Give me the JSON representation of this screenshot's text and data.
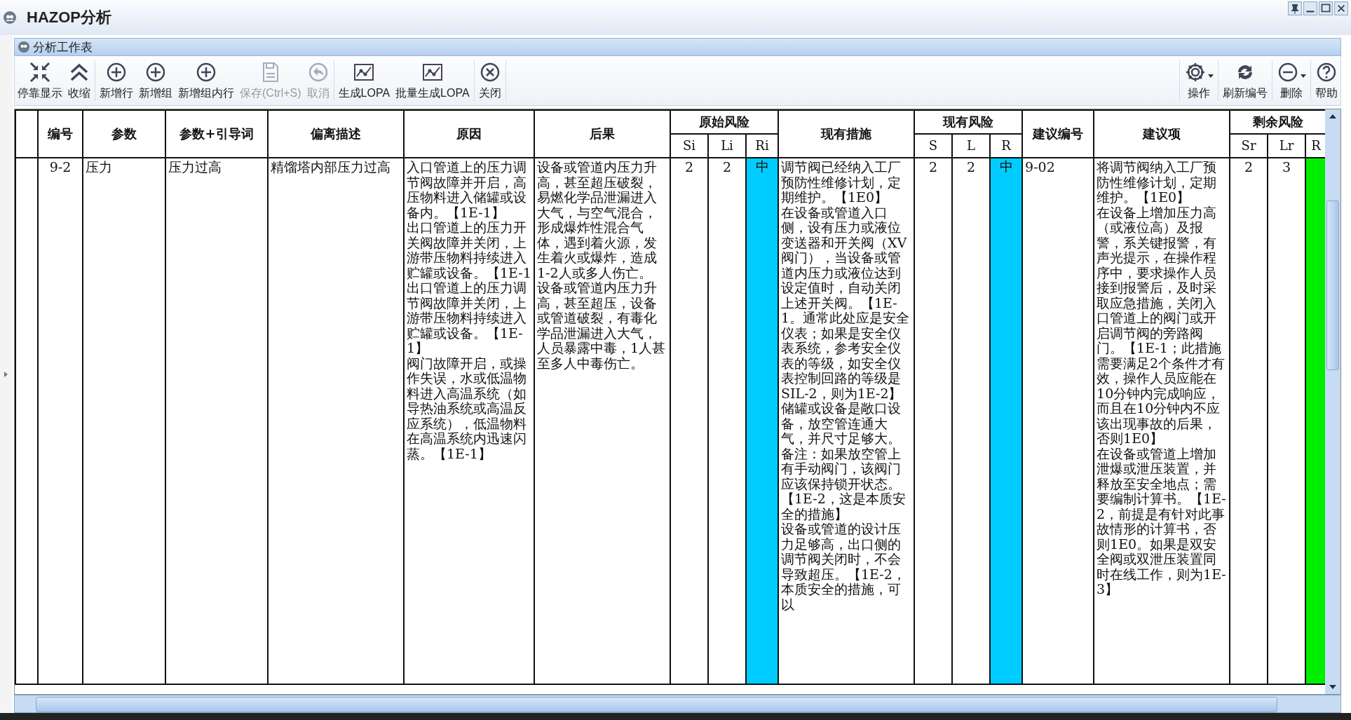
{
  "window": {
    "title": "HAZOP分析"
  },
  "panel": {
    "title": "分析工作表"
  },
  "toolbar": {
    "left": [
      {
        "kind": "dock",
        "label": "停靠显示",
        "disabled": false
      },
      {
        "kind": "collapse",
        "label": "收缩",
        "disabled": false
      },
      {
        "kind": "add",
        "label": "新增行",
        "disabled": false
      },
      {
        "kind": "add",
        "label": "新增组",
        "disabled": false
      },
      {
        "kind": "add",
        "label": "新增组内行",
        "disabled": false
      },
      {
        "kind": "save",
        "label": "保存(Ctrl+S)",
        "disabled": true
      },
      {
        "kind": "undo",
        "label": "取消",
        "disabled": true
      },
      {
        "kind": "chart",
        "label": "生成LOPA",
        "disabled": false
      },
      {
        "kind": "chart",
        "label": "批量生成LOPA",
        "disabled": false
      },
      {
        "kind": "close",
        "label": "关闭",
        "disabled": false
      }
    ],
    "right": [
      {
        "kind": "gear",
        "label": "操作",
        "disabled": false,
        "has_menu": true
      },
      {
        "kind": "refresh",
        "label": "刷新编号",
        "disabled": false,
        "has_menu": false
      },
      {
        "kind": "minus",
        "label": "删除",
        "disabled": false,
        "has_menu": true
      },
      {
        "kind": "help",
        "label": "帮助",
        "disabled": false,
        "has_menu": false
      }
    ]
  },
  "table": {
    "columns": [
      {
        "label": "编号"
      },
      {
        "label": "参数"
      },
      {
        "label": "参数+引导词"
      },
      {
        "label": "偏离描述"
      },
      {
        "label": "原因"
      },
      {
        "label": "后果"
      },
      {
        "label": "原始风险",
        "sub": [
          "Si",
          "Li",
          "Ri"
        ]
      },
      {
        "label": "现有措施"
      },
      {
        "label": "现有风险",
        "sub": [
          "S",
          "L",
          "R"
        ]
      },
      {
        "label": "建议编号"
      },
      {
        "label": "建议项"
      },
      {
        "label": "剩余风险",
        "sub": [
          "Sr",
          "Lr",
          "R"
        ]
      }
    ],
    "rows": [
      {
        "id": "9-2",
        "parameter": "压力",
        "guideword": "压力过高",
        "deviation": "精馏塔内部压力过高",
        "cause": [
          "入口管道上的压力调节阀故障并开启，高压物料进入储罐或设备内。【1E-1】",
          "出口管道上的压力开关阀故障并关闭，上游带压物料持续进入贮罐或设备。【1E-1",
          "出口管道上的压力调节阀故障并关闭，上游带压物料持续进入贮罐或设备。【1E-1】",
          "阀门故障开启，或操作失误，水或低温物料进入高温系统（如导热油系统或高温反应系统），低温物料在高温系统内迅速闪蒸。【1E-1】"
        ],
        "consequence": [
          "设备或管道内压力升高，甚至超压破裂，易燃化学品泄漏进入大气，与空气混合，形成爆炸性混合气体，遇到着火源，发生着火或爆炸，造成1-2人或多人伤亡。",
          "设备或管道内压力升高，甚至超压，设备或管道破裂，有毒化学品泄漏进入大气，人员暴露中毒，1人甚至多人中毒伤亡。"
        ],
        "initial_risk": {
          "s": "2",
          "l": "2",
          "r": "中",
          "color": "#00ccff"
        },
        "measures": [
          "调节阀已经纳入工厂预防性维修计划，定期维护。【1E0】",
          "在设备或管道入口侧，设有压力或液位变送器和开关阀（XV阀门），当设备或管道内压力或液位达到设定值时，自动关闭上述开关阀。【1E-1。通常此处应是安全仪表；如果是安全仪表系统，参考安全仪表的等级，如安全仪表控制回路的等级是SIL-2，则为1E-2】",
          "储罐或设备是敞口设备，放空管连通大气，并尺寸足够大。备注：如果放空管上有手动阀门，该阀门应该保持锁开状态。【1E-2，这是本质安全的措施】",
          "设备或管道的设计压力足够高，出口侧的调节阀关闭时，不会导致超压。【1E-2，本质安全的措施，可以"
        ],
        "current_risk": {
          "s": "2",
          "l": "2",
          "r": "中",
          "color": "#00ccff"
        },
        "recommendation_id": "9-02",
        "recommendation": [
          "将调节阀纳入工厂预防性维修计划，定期维护。【1E0】",
          "在设备上增加压力高（或液位高）及报警，系关键报警，有声光提示，在操作程序中，要求操作人员接到报警后，及时采取应急措施，关闭入口管道上的阀门或开启调节阀的旁路阀门。【1E-1；此措施需要满足2个条件才有效，操作人员应能在10分钟内完成响应，而且在10分钟内不应该出现事故的后果，否则1E0】",
          "在设备或管道上增加泄爆或泄压装置，并释放至安全地点；需要编制计算书。【1E-2，前提是有针对此事故情形的计算书，否则1E0。如果是双安全阀或双泄压装置同时在线工作，则为1E-3】"
        ],
        "residual_risk": {
          "s": "2",
          "l": "3",
          "color": "#00ee00"
        }
      }
    ]
  }
}
